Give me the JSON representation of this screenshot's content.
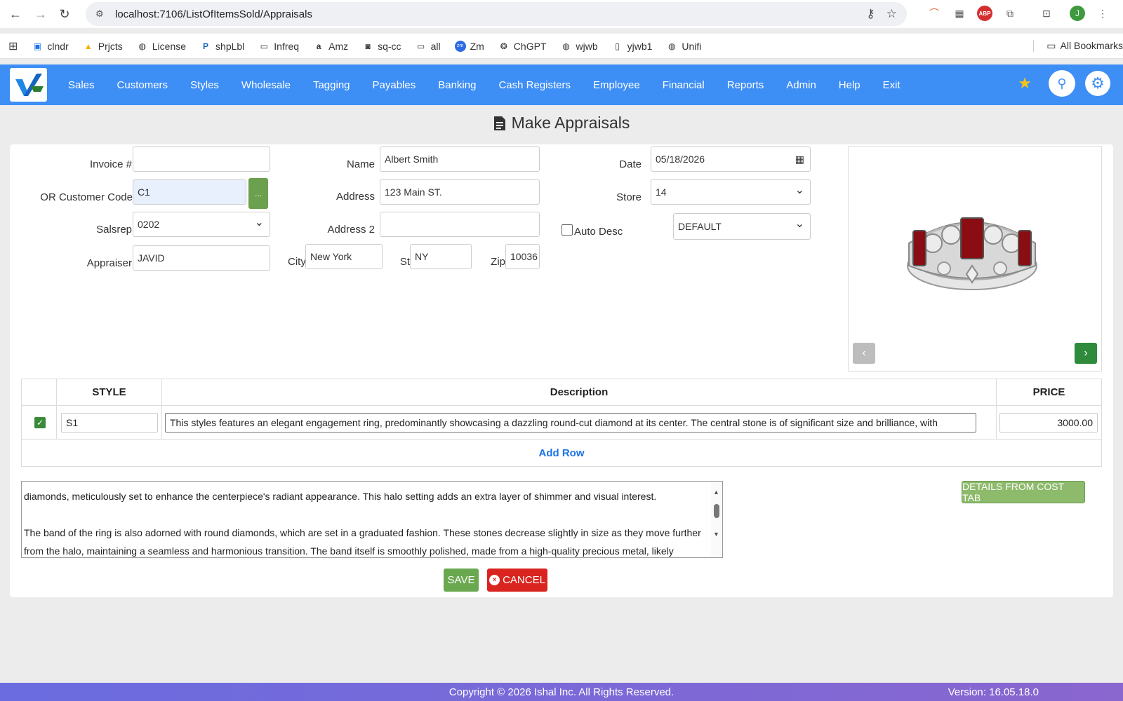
{
  "browser": {
    "url": "localhost:7106/ListOfItemsSold/Appraisals",
    "bookmarks": [
      "clndr",
      "Prjcts",
      "License",
      "shpLbl",
      "Infreq",
      "Amz",
      "sq-cc",
      "all",
      "Zm",
      "ChGPT",
      "wjwb",
      "yjwb1",
      "Unifi"
    ],
    "all_bookmarks": "All Bookmarks",
    "profile_initial": "J",
    "abp": "ABP"
  },
  "nav": {
    "items": [
      "Sales",
      "Customers",
      "Styles",
      "Wholesale",
      "Tagging",
      "Payables",
      "Banking",
      "Cash Registers",
      "Employee",
      "Financial",
      "Reports",
      "Admin",
      "Help",
      "Exit"
    ]
  },
  "page": {
    "title": "Make Appraisals"
  },
  "form": {
    "invoice_label": "Invoice #",
    "invoice_value": "",
    "customer_code_label": "OR Customer Code",
    "customer_code_value": "C1",
    "lookup_button": "...",
    "salesrep_label": "Salsrep",
    "salesrep_value": "0202",
    "appraiser_label": "Appraiser",
    "appraiser_value": "JAVID",
    "name_label": "Name",
    "name_value": "Albert Smith",
    "address_label": "Address",
    "address_value": "123 Main ST.",
    "address2_label": "Address 2",
    "address2_value": "",
    "city_label": "City",
    "city_value": "New York",
    "state_label": "St",
    "state_value": "NY",
    "zip_label": "Zip",
    "zip_value": "10036",
    "date_label": "Date",
    "date_value": "05/18/2026",
    "store_label": "Store",
    "store_value": "14",
    "auto_desc_label": "Auto Desc",
    "auto_desc_checked": false,
    "template_value": "DEFAULT"
  },
  "table": {
    "headers": [
      "",
      "STYLE",
      "Description",
      "PRICE"
    ],
    "rows": [
      {
        "checked": true,
        "style": "S1",
        "description": "This styles features an elegant engagement ring, predominantly showcasing a dazzling round-cut diamond at its center. The central stone is of significant size and brilliance, with",
        "price": "3000.00"
      }
    ],
    "add_row": "Add Row"
  },
  "long_description": {
    "paragraph1": "diamonds, meticulously set to enhance the centerpiece's radiant appearance. This halo setting adds an extra layer of shimmer and visual interest.",
    "paragraph2a": "The band of the ring is also adorned with round diamonds, which are set in a graduated fashion. These stones decrease slightly in size as they move further",
    "paragraph2b": "from the halo, maintaining a seamless and harmonious transition. The band itself is smoothly polished, made from a high-quality precious metal, likely platinum"
  },
  "buttons": {
    "details": "DETAILS FROM COST TAB",
    "save": "SAVE",
    "cancel": "CANCEL"
  },
  "footer": {
    "copyright": "Copyright © 2026 Ishal Inc. All Rights Reserved.",
    "version": "Version: 16.05.18.0"
  },
  "colors": {
    "nav_bg": "#3d8ef5",
    "save": "#6aa84f",
    "cancel": "#d9241f",
    "details": "#8dba6b",
    "gem": "#8b0d14"
  }
}
